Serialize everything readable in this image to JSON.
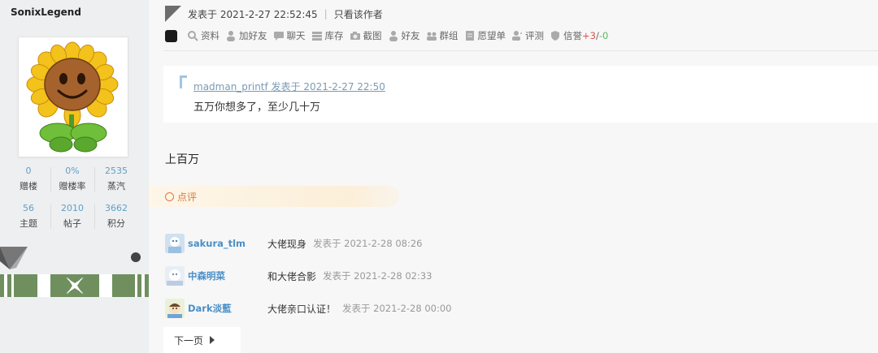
{
  "author": {
    "username": "SonixLegend",
    "stats": [
      {
        "value": "0",
        "label": "赠楼"
      },
      {
        "value": "0%",
        "label": "赠楼率"
      },
      {
        "value": "2535",
        "label": "蒸汽"
      },
      {
        "value": "56",
        "label": "主题"
      },
      {
        "value": "2010",
        "label": "帖子"
      },
      {
        "value": "3662",
        "label": "积分"
      }
    ]
  },
  "post": {
    "posted_on": "发表于 2021-2-27 22:52:45",
    "only_author": "只看该作者",
    "actions": {
      "profile": "资料",
      "add_friend": "加好友",
      "chat": "聊天",
      "library": "库存",
      "screenshot": "截图",
      "friends": "好友",
      "groups": "群组",
      "wishlist": "愿望单",
      "reviews": "评测",
      "credit": "信誉",
      "credit_plus": "+3",
      "credit_sep": "/",
      "credit_minus": "-0"
    },
    "quote": {
      "meta": "madman_printf 发表于 2021-2-27 22:50",
      "text": "五万你想多了，至少几十万"
    },
    "reply_text": "上百万"
  },
  "comment_label": "点评",
  "comments": [
    {
      "user": "sakura_tlm",
      "text": "大佬现身",
      "time": "发表于 2021-2-28 08:26"
    },
    {
      "user": "中森明菜",
      "text": "和大佬合影",
      "time": "发表于 2021-2-28 02:33"
    },
    {
      "user": "Dark淡藍",
      "text": "大佬亲口认证！",
      "time": "发表于 2021-2-28 00:00"
    }
  ],
  "pager": {
    "next": "下一页"
  }
}
